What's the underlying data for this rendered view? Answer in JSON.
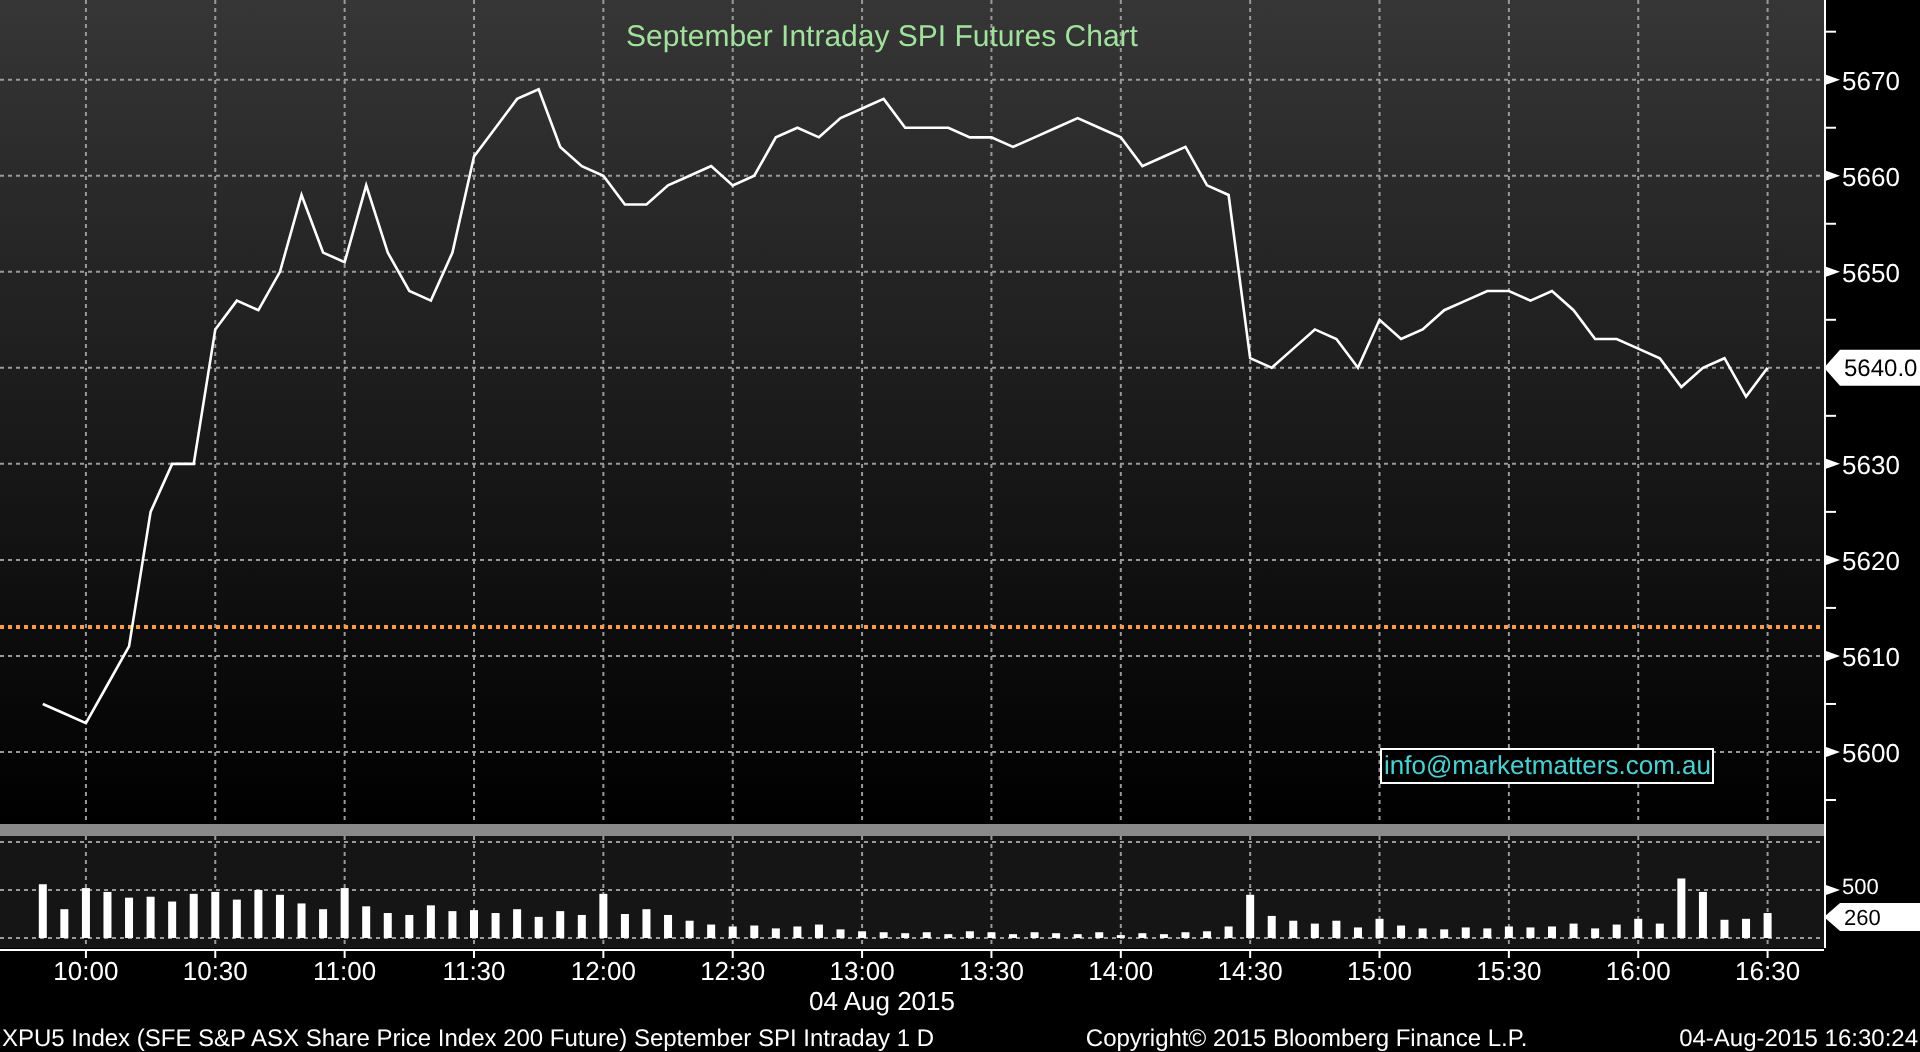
{
  "price_chart": {
    "title": "September Intraday SPI Futures Chart",
    "annotation_label": "info@marketmatters.com.au",
    "chart_data": {
      "type": "line",
      "grid": true,
      "ylim": [
        5592.5,
        5678.3
      ],
      "yticks": [
        5600,
        5610,
        5620,
        5630,
        5650,
        5660,
        5670
      ],
      "values": [
        5605,
        5604,
        5603,
        5607,
        5611,
        5625,
        5630,
        5630,
        5644,
        5647,
        5646,
        5650,
        5658,
        5652,
        5651,
        5659,
        5652,
        5648,
        5647,
        5652,
        5662,
        5665,
        5668,
        5669,
        5663,
        5661,
        5660,
        5657,
        5657,
        5659,
        5660,
        5661,
        5659,
        5660,
        5664,
        5665,
        5664,
        5666,
        5667,
        5668,
        5665,
        5665,
        5665,
        5664,
        5664,
        5663,
        5664,
        5665,
        5666,
        5665,
        5664,
        5661,
        5662,
        5663,
        5659,
        5658,
        5641,
        5640,
        5642,
        5644,
        5643,
        5640,
        5645,
        5643,
        5644,
        5646,
        5647,
        5648,
        5648,
        5647,
        5648,
        5646,
        5643,
        5643,
        5642,
        5641,
        5638,
        5640,
        5641,
        5637,
        5640
      ],
      "ref_lines": [
        {
          "axis": "y",
          "value": 5613,
          "color": "#ff9d2e"
        }
      ],
      "annotations": [
        "5640.0"
      ]
    }
  },
  "volume_chart": {
    "chart_data": {
      "type": "bar",
      "grid": true,
      "xlabel": "04 Aug 2015",
      "ylim": [
        0,
        1000
      ],
      "categories": [
        null,
        null,
        "10:00",
        null,
        null,
        null,
        null,
        null,
        "10:30",
        null,
        null,
        null,
        null,
        null,
        "11:00",
        null,
        null,
        null,
        null,
        null,
        "11:30",
        null,
        null,
        null,
        null,
        null,
        "12:00",
        null,
        null,
        null,
        null,
        null,
        "12:30",
        null,
        null,
        null,
        null,
        null,
        "13:00",
        null,
        null,
        null,
        null,
        null,
        "13:30",
        null,
        null,
        null,
        null,
        null,
        "14:00",
        null,
        null,
        null,
        null,
        null,
        "14:30",
        null,
        null,
        null,
        null,
        null,
        "15:00",
        null,
        null,
        null,
        null,
        null,
        "15:30",
        null,
        null,
        null,
        null,
        null,
        "16:00",
        null,
        null,
        null,
        null,
        null,
        "16:30"
      ],
      "yticks": [
        500
      ],
      "values": [
        560,
        300,
        520,
        480,
        420,
        430,
        380,
        460,
        480,
        400,
        500,
        450,
        360,
        300,
        520,
        330,
        260,
        240,
        340,
        280,
        290,
        260,
        300,
        220,
        280,
        240,
        460,
        250,
        300,
        240,
        180,
        140,
        120,
        130,
        100,
        120,
        140,
        90,
        70,
        60,
        50,
        60,
        40,
        70,
        60,
        40,
        60,
        50,
        40,
        60,
        30,
        50,
        40,
        60,
        70,
        120,
        450,
        230,
        180,
        150,
        180,
        110,
        200,
        130,
        100,
        90,
        110,
        100,
        120,
        110,
        120,
        150,
        100,
        140,
        200,
        150,
        620,
        480,
        190,
        200,
        260
      ],
      "annotations": [
        "260"
      ]
    }
  },
  "footer": {
    "security": "XPU5 Index (SFE S&P ASX Share Price Index 200 Future) September SPI Intraday 1 D",
    "copyright": "Copyright© 2015 Bloomberg Finance L.P.",
    "timestamp": "04-Aug-2015 16:30:24"
  }
}
